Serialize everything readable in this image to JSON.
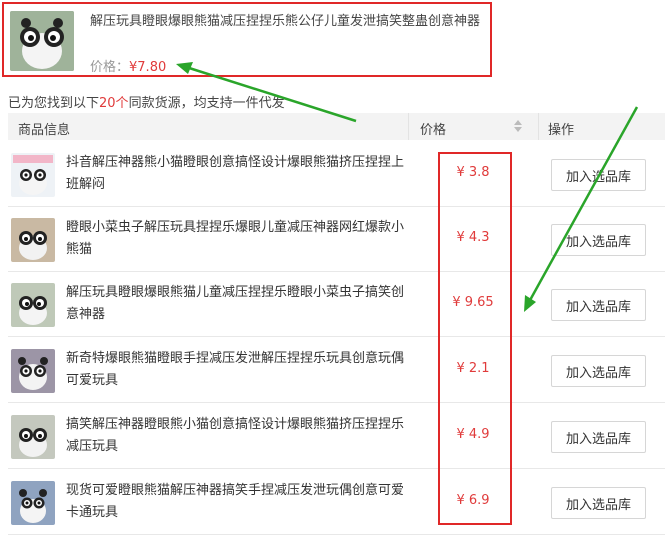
{
  "top_product": {
    "title": "解压玩具瞪眼爆眼熊猫减压捏捏乐熊公仔儿童发泄搞笑整蛊创意神器",
    "price_label": "价格：",
    "price_value": "¥7.80"
  },
  "found": {
    "prefix": "已为您找到以下",
    "count": "20个",
    "suffix": "同款货源，均支持一件代发"
  },
  "table": {
    "headers": {
      "info": "商品信息",
      "price": "价格",
      "action": "操作"
    },
    "rows": [
      {
        "title": "抖音解压神器熊小猫瞪眼创意搞怪设计爆眼熊猫挤压捏捏上班解闷",
        "price": "¥ 3.8",
        "button": "加入选品库"
      },
      {
        "title": "瞪眼小菜虫子解压玩具捏捏乐爆眼儿童减压神器网红爆款小熊猫",
        "price": "¥ 4.3",
        "button": "加入选品库"
      },
      {
        "title": "解压玩具瞪眼爆眼熊猫儿童减压捏捏乐瞪眼小菜虫子搞笑创意神器",
        "price": "¥ 9.65",
        "button": "加入选品库"
      },
      {
        "title": "新奇特爆眼熊猫瞪眼手捏减压发泄解压捏捏乐玩具创意玩偶可爱玩具",
        "price": "¥ 2.1",
        "button": "加入选品库"
      },
      {
        "title": "搞笑解压神器瞪眼熊小猫创意搞怪设计爆眼熊猫挤压捏捏乐减压玩具",
        "price": "¥ 4.9",
        "button": "加入选品库"
      },
      {
        "title": "现货可爱瞪眼熊猫解压神器搞笑手捏减压发泄玩偶创意可爱卡通玩具",
        "price": "¥ 6.9",
        "button": "加入选品库"
      }
    ]
  },
  "colors": {
    "accent_red": "#e03b3b",
    "highlight_red": "#e02828",
    "arrow_green": "#2aa52a"
  },
  "icons": {
    "sort": "sort-arrows-icon",
    "thumbnail": "panda-toy-icon"
  }
}
